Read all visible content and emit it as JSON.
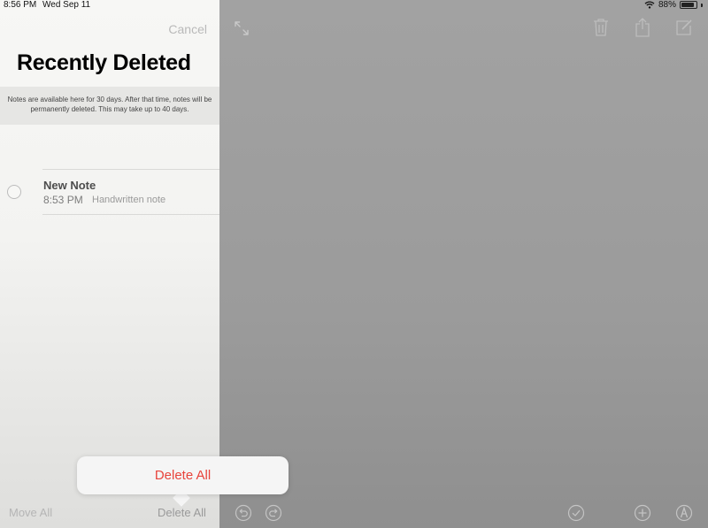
{
  "status_bar": {
    "time": "8:56 PM",
    "date": "Wed Sep 11",
    "battery": "88%",
    "battery_level": 0.88,
    "wifi_icon": "wifi-icon",
    "battery_icon": "battery-icon"
  },
  "sidebar": {
    "cancel_label": "Cancel",
    "title": "Recently Deleted",
    "banner_text": "Notes are available here for 30 days. After that time, notes will be permanently deleted. This may take up to 40 days.",
    "notes": [
      {
        "title": "New Note",
        "time": "8:53 PM",
        "subtitle": "Handwritten note"
      }
    ],
    "move_all_label": "Move All",
    "delete_all_label": "Delete All"
  },
  "toolbar": {
    "top_icons": [
      "expand-icon",
      "trash-icon",
      "share-icon",
      "compose-icon"
    ],
    "bottom_icons": [
      "undo-icon",
      "redo-icon",
      "checklist-icon",
      "add-icon",
      "markup-icon"
    ]
  },
  "popover": {
    "delete_all_label": "Delete All"
  },
  "colors": {
    "destructive": "#e8433b",
    "disabled": "#b5b5b5",
    "canvas": "#9a9a9a",
    "sidebar": "#f7f7f5"
  }
}
